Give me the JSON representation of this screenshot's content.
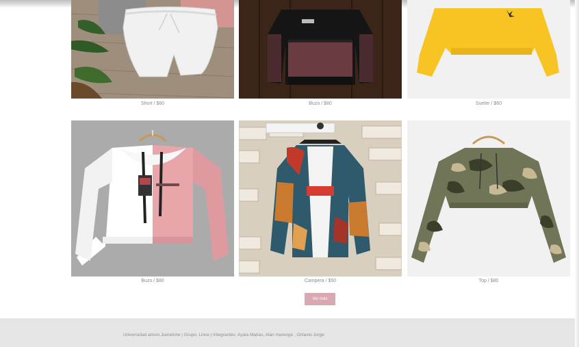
{
  "products": [
    {
      "caption": "Short / $60",
      "image": "white-shorts"
    },
    {
      "caption": "Buzo / $80",
      "image": "black-maroon-hoodie"
    },
    {
      "caption": "Sueter / $60",
      "image": "yellow-sweater"
    },
    {
      "caption": "Buzo / $80",
      "image": "white-pink-hoodie"
    },
    {
      "caption": "Campera / $50",
      "image": "printed-jacket"
    },
    {
      "caption": "Top / $80",
      "image": "camo-crop-hoodie"
    }
  ],
  "more_button": "Ver más",
  "footer": {
    "text": "Universidad arturo Jueretche | Grupo: Lince | Integrantes: Ayala Matías, Alan marengo , Octavio Jorge"
  },
  "colors": {
    "button": "#d8a9b1",
    "footer": "#e6e6e6",
    "caption": "#8a8a8a"
  }
}
